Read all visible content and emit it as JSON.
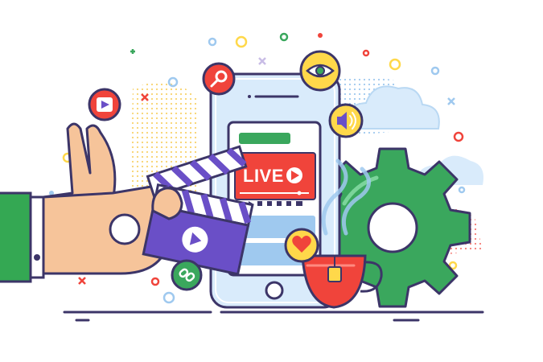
{
  "screen": {
    "live_label": "LIVE"
  },
  "icons": [
    "play-icon",
    "search-icon",
    "eye-icon",
    "speaker-icon",
    "heart-icon",
    "link-icon",
    "clapperboard-icon",
    "gear-icon",
    "tea-cup-icon",
    "cloud-icon"
  ],
  "colors": {
    "outline": "#3c3568",
    "red": "#f0443b",
    "purple": "#6a4fc7",
    "green": "#3aa75d",
    "yellow": "#ffd84a",
    "blue_light": "#d9ebfb",
    "skin": "#f6c49a",
    "sleeve": "#34a853"
  }
}
